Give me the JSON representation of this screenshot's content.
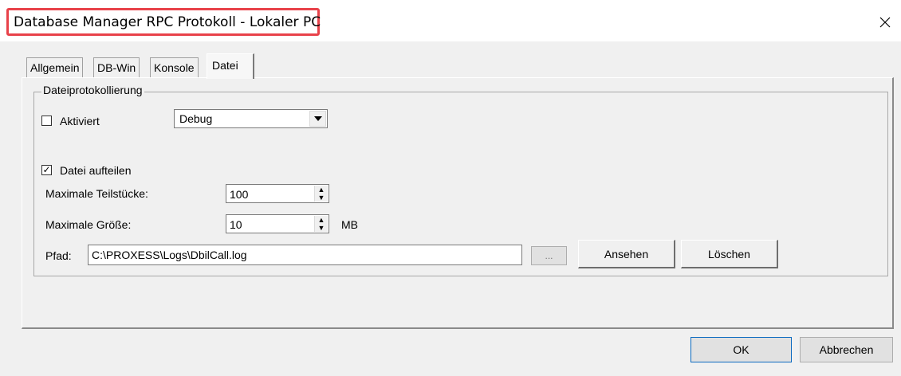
{
  "window": {
    "title": "Database Manager RPC Protokoll - Lokaler PC",
    "close_symbol": "✕"
  },
  "tabs": [
    {
      "label": "Allgemein",
      "active": false
    },
    {
      "label": "DB-Win",
      "active": false
    },
    {
      "label": "Konsole",
      "active": false
    },
    {
      "label": "Datei",
      "active": true
    }
  ],
  "file_logging": {
    "group_label": "Dateiprotokollierung",
    "enabled": {
      "label": "Aktiviert",
      "checked": false
    },
    "level": {
      "value": "Debug",
      "icon": "chevron-down-icon"
    },
    "split_file": {
      "label": "Datei aufteilen",
      "checked": true,
      "check_mark": "✓"
    },
    "max_parts": {
      "label": "Maximale Teilstücke:",
      "value": "100"
    },
    "max_size": {
      "label": "Maximale Größe:",
      "value": "10",
      "unit": "MB"
    },
    "path": {
      "label": "Pfad:",
      "value": "C:\\PROXESS\\Logs\\DbilCall.log"
    },
    "browse_label": "...",
    "view_label": "Ansehen",
    "delete_label": "Löschen"
  },
  "footer": {
    "ok_label": "OK",
    "cancel_label": "Abbrechen"
  }
}
